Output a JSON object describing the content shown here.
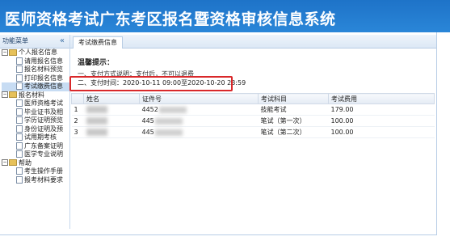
{
  "header": {
    "title": "医师资格考试广东考区报名暨资格审核信息系统"
  },
  "sidebar": {
    "title": "功能菜单",
    "collapse_glyph": "«",
    "groups": [
      {
        "label": "个人报名信息",
        "expanded": true,
        "items": [
          "请用报名信息",
          "报名材料预览",
          "打印报名信息",
          "考试缴费信息"
        ]
      },
      {
        "label": "报名材料",
        "expanded": true,
        "items": [
          "医师资格考试",
          "毕业证书及相",
          "学历证明预览",
          "身份证明及预",
          "试用期考核",
          "广东备案证明",
          "医学专业说明"
        ]
      },
      {
        "label": "帮助",
        "expanded": true,
        "items": [
          "考生操作手册",
          "报考材料要求"
        ]
      }
    ],
    "selected_item": "考试缴费信息"
  },
  "tab": {
    "label": "考试缴费信息"
  },
  "tips": {
    "title": "温馨提示：",
    "line1": "一、支付方式说明：支付后，不可以退费",
    "line2": "二、支付时间：2020-10-11 09:00至2020-10-20 23:59"
  },
  "table": {
    "headers": [
      "姓名",
      "证件号",
      "考试科目",
      "考试费用"
    ],
    "rows": [
      {
        "index": "1",
        "id": "4452",
        "subject": "技能考试",
        "fee": "179.00"
      },
      {
        "index": "2",
        "id": "445",
        "subject": "笔试（第一次）",
        "fee": "100.00"
      },
      {
        "index": "3",
        "id": "445",
        "subject": "笔试（第二次）",
        "fee": "100.00"
      }
    ]
  },
  "colors": {
    "header_blue": "#1e73c8",
    "highlight_red": "#d9282a",
    "selected_bg": "#c7dcf3"
  }
}
